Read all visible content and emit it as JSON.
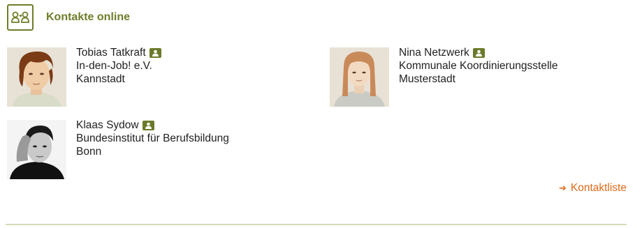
{
  "widget": {
    "title": "Kontakte online",
    "header_icon": "contacts-group-icon"
  },
  "contacts": [
    {
      "name": "Tobias Tatkraft",
      "organization": "In-den-Job! e.V.",
      "location": "Kannstadt",
      "icon": "profile-card-icon"
    },
    {
      "name": "Nina Netzwerk",
      "organization": "Kommunale Koordinierungsstelle",
      "location": "Musterstadt",
      "icon": "profile-card-icon"
    },
    {
      "name": "Klaas Sydow",
      "organization": "Bundesinstitut für Berufsbildung",
      "location": "Bonn",
      "icon": "profile-card-icon"
    }
  ],
  "footer": {
    "link_label": "Kontaktliste",
    "link_icon": "arrow-right-icon"
  },
  "colors": {
    "accent_olive": "#6f7d2a",
    "link_orange": "#e06a1a",
    "divider": "#d7d9b9"
  }
}
